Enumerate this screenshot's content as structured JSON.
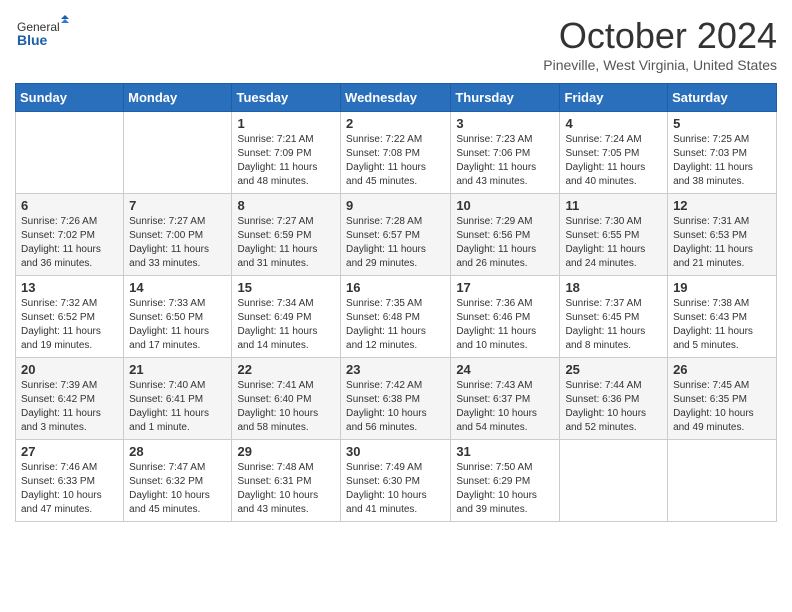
{
  "logo": {
    "general": "General",
    "blue": "Blue"
  },
  "title": "October 2024",
  "subtitle": "Pineville, West Virginia, United States",
  "days_of_week": [
    "Sunday",
    "Monday",
    "Tuesday",
    "Wednesday",
    "Thursday",
    "Friday",
    "Saturday"
  ],
  "weeks": [
    [
      {
        "day": "",
        "info": ""
      },
      {
        "day": "",
        "info": ""
      },
      {
        "day": "1",
        "info": "Sunrise: 7:21 AM\nSunset: 7:09 PM\nDaylight: 11 hours and 48 minutes."
      },
      {
        "day": "2",
        "info": "Sunrise: 7:22 AM\nSunset: 7:08 PM\nDaylight: 11 hours and 45 minutes."
      },
      {
        "day": "3",
        "info": "Sunrise: 7:23 AM\nSunset: 7:06 PM\nDaylight: 11 hours and 43 minutes."
      },
      {
        "day": "4",
        "info": "Sunrise: 7:24 AM\nSunset: 7:05 PM\nDaylight: 11 hours and 40 minutes."
      },
      {
        "day": "5",
        "info": "Sunrise: 7:25 AM\nSunset: 7:03 PM\nDaylight: 11 hours and 38 minutes."
      }
    ],
    [
      {
        "day": "6",
        "info": "Sunrise: 7:26 AM\nSunset: 7:02 PM\nDaylight: 11 hours and 36 minutes."
      },
      {
        "day": "7",
        "info": "Sunrise: 7:27 AM\nSunset: 7:00 PM\nDaylight: 11 hours and 33 minutes."
      },
      {
        "day": "8",
        "info": "Sunrise: 7:27 AM\nSunset: 6:59 PM\nDaylight: 11 hours and 31 minutes."
      },
      {
        "day": "9",
        "info": "Sunrise: 7:28 AM\nSunset: 6:57 PM\nDaylight: 11 hours and 29 minutes."
      },
      {
        "day": "10",
        "info": "Sunrise: 7:29 AM\nSunset: 6:56 PM\nDaylight: 11 hours and 26 minutes."
      },
      {
        "day": "11",
        "info": "Sunrise: 7:30 AM\nSunset: 6:55 PM\nDaylight: 11 hours and 24 minutes."
      },
      {
        "day": "12",
        "info": "Sunrise: 7:31 AM\nSunset: 6:53 PM\nDaylight: 11 hours and 21 minutes."
      }
    ],
    [
      {
        "day": "13",
        "info": "Sunrise: 7:32 AM\nSunset: 6:52 PM\nDaylight: 11 hours and 19 minutes."
      },
      {
        "day": "14",
        "info": "Sunrise: 7:33 AM\nSunset: 6:50 PM\nDaylight: 11 hours and 17 minutes."
      },
      {
        "day": "15",
        "info": "Sunrise: 7:34 AM\nSunset: 6:49 PM\nDaylight: 11 hours and 14 minutes."
      },
      {
        "day": "16",
        "info": "Sunrise: 7:35 AM\nSunset: 6:48 PM\nDaylight: 11 hours and 12 minutes."
      },
      {
        "day": "17",
        "info": "Sunrise: 7:36 AM\nSunset: 6:46 PM\nDaylight: 11 hours and 10 minutes."
      },
      {
        "day": "18",
        "info": "Sunrise: 7:37 AM\nSunset: 6:45 PM\nDaylight: 11 hours and 8 minutes."
      },
      {
        "day": "19",
        "info": "Sunrise: 7:38 AM\nSunset: 6:43 PM\nDaylight: 11 hours and 5 minutes."
      }
    ],
    [
      {
        "day": "20",
        "info": "Sunrise: 7:39 AM\nSunset: 6:42 PM\nDaylight: 11 hours and 3 minutes."
      },
      {
        "day": "21",
        "info": "Sunrise: 7:40 AM\nSunset: 6:41 PM\nDaylight: 11 hours and 1 minute."
      },
      {
        "day": "22",
        "info": "Sunrise: 7:41 AM\nSunset: 6:40 PM\nDaylight: 10 hours and 58 minutes."
      },
      {
        "day": "23",
        "info": "Sunrise: 7:42 AM\nSunset: 6:38 PM\nDaylight: 10 hours and 56 minutes."
      },
      {
        "day": "24",
        "info": "Sunrise: 7:43 AM\nSunset: 6:37 PM\nDaylight: 10 hours and 54 minutes."
      },
      {
        "day": "25",
        "info": "Sunrise: 7:44 AM\nSunset: 6:36 PM\nDaylight: 10 hours and 52 minutes."
      },
      {
        "day": "26",
        "info": "Sunrise: 7:45 AM\nSunset: 6:35 PM\nDaylight: 10 hours and 49 minutes."
      }
    ],
    [
      {
        "day": "27",
        "info": "Sunrise: 7:46 AM\nSunset: 6:33 PM\nDaylight: 10 hours and 47 minutes."
      },
      {
        "day": "28",
        "info": "Sunrise: 7:47 AM\nSunset: 6:32 PM\nDaylight: 10 hours and 45 minutes."
      },
      {
        "day": "29",
        "info": "Sunrise: 7:48 AM\nSunset: 6:31 PM\nDaylight: 10 hours and 43 minutes."
      },
      {
        "day": "30",
        "info": "Sunrise: 7:49 AM\nSunset: 6:30 PM\nDaylight: 10 hours and 41 minutes."
      },
      {
        "day": "31",
        "info": "Sunrise: 7:50 AM\nSunset: 6:29 PM\nDaylight: 10 hours and 39 minutes."
      },
      {
        "day": "",
        "info": ""
      },
      {
        "day": "",
        "info": ""
      }
    ]
  ]
}
